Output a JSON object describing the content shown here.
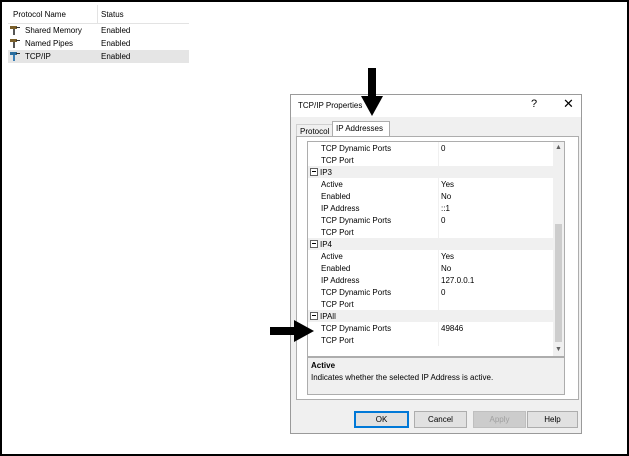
{
  "list": {
    "columns": [
      "Protocol Name",
      "Status"
    ],
    "rows": [
      {
        "name": "Shared Memory",
        "status": "Enabled"
      },
      {
        "name": "Named Pipes",
        "status": "Enabled"
      },
      {
        "name": "TCP/IP",
        "status": "Enabled"
      }
    ]
  },
  "dialog": {
    "title": "TCP/IP Properties",
    "help": "?",
    "close": "✕",
    "tabs": [
      "Protocol",
      "IP Addresses"
    ],
    "grid": [
      {
        "type": "prop",
        "label": "TCP Dynamic Ports",
        "value": "0"
      },
      {
        "type": "prop",
        "label": "TCP Port",
        "value": ""
      },
      {
        "type": "cat",
        "label": "IP3"
      },
      {
        "type": "prop",
        "label": "Active",
        "value": "Yes"
      },
      {
        "type": "prop",
        "label": "Enabled",
        "value": "No"
      },
      {
        "type": "prop",
        "label": "IP Address",
        "value": "::1"
      },
      {
        "type": "prop",
        "label": "TCP Dynamic Ports",
        "value": "0"
      },
      {
        "type": "prop",
        "label": "TCP Port",
        "value": ""
      },
      {
        "type": "cat",
        "label": "IP4"
      },
      {
        "type": "prop",
        "label": "Active",
        "value": "Yes"
      },
      {
        "type": "prop",
        "label": "Enabled",
        "value": "No"
      },
      {
        "type": "prop",
        "label": "IP Address",
        "value": "127.0.0.1"
      },
      {
        "type": "prop",
        "label": "TCP Dynamic Ports",
        "value": "0"
      },
      {
        "type": "prop",
        "label": "TCP Port",
        "value": ""
      },
      {
        "type": "cat",
        "label": "IPAll"
      },
      {
        "type": "prop",
        "label": "TCP Dynamic Ports",
        "value": "49846"
      },
      {
        "type": "prop",
        "label": "TCP Port",
        "value": ""
      }
    ],
    "description": {
      "title": "Active",
      "text": "Indicates whether the selected IP Address is active."
    },
    "buttons": {
      "ok": "OK",
      "cancel": "Cancel",
      "apply": "Apply",
      "help": "Help"
    }
  },
  "colors": {
    "accent": "#0078d7",
    "selection": "#e5e5e5",
    "dialog_bg": "#f0f0f0"
  }
}
